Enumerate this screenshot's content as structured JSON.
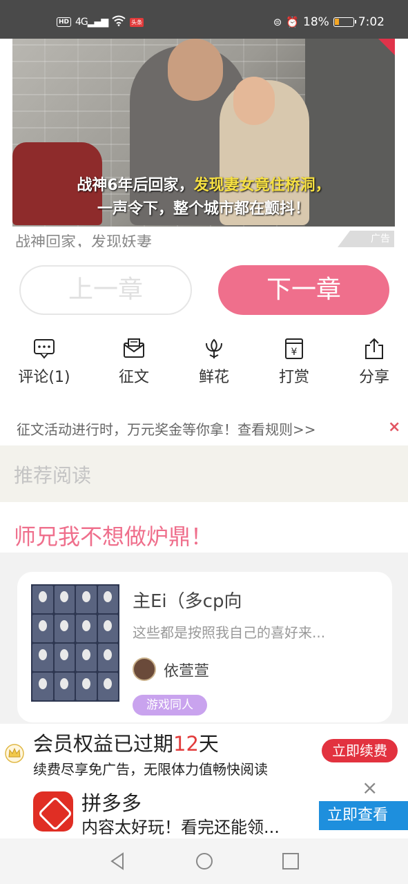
{
  "status_bar": {
    "network_badge": "HD",
    "signal": "4G",
    "app_badge": "头条",
    "battery_percent": "18%",
    "battery_level": 0.18,
    "time": "7:02"
  },
  "ad": {
    "caption_line1_plain": "战神6年后回家，",
    "caption_line1_highlight": "发现妻女竟住桥洞，",
    "caption_line2": "一声令下，整个城市都在颤抖！",
    "subtitle": "战神回家，发现妖妻",
    "badge": "广告"
  },
  "chapter_nav": {
    "prev": "上一章",
    "next": "下一章"
  },
  "actions": [
    {
      "label": "评论(1)",
      "icon": "comment-icon"
    },
    {
      "label": "征文",
      "icon": "mail-icon"
    },
    {
      "label": "鲜花",
      "icon": "flower-icon"
    },
    {
      "label": "打赏",
      "icon": "reward-icon"
    },
    {
      "label": "分享",
      "icon": "share-icon"
    }
  ],
  "notice": {
    "text": "征文活动进行时，万元奖金等你拿！查看规则>>",
    "close": "×"
  },
  "recommend": {
    "header": "推荐阅读",
    "book_title": "师兄我不想做炉鼎！",
    "card": {
      "title": "主Ei（多cp向",
      "description": "这些都是按照我自己的喜好来...",
      "author": "依萱萱",
      "tag": "游戏同人"
    }
  },
  "membership": {
    "title_prefix": "会员权益已过期",
    "title_days": "12",
    "title_suffix": "天",
    "subtitle": "续费尽享免广告，无限体力值畅快阅读",
    "button": "立即续费"
  },
  "bottom_ad": {
    "app_name": "拼多多",
    "description": "内容太好玩！看完还能领...",
    "button": "立即查看",
    "close": "×"
  },
  "colors": {
    "accent_pink": "#ef6f8c",
    "renew_red": "#e2323f",
    "pdd_red": "#e02e24",
    "pdd_blue": "#1e8fdd",
    "tag_purple": "#c9a3ee"
  }
}
